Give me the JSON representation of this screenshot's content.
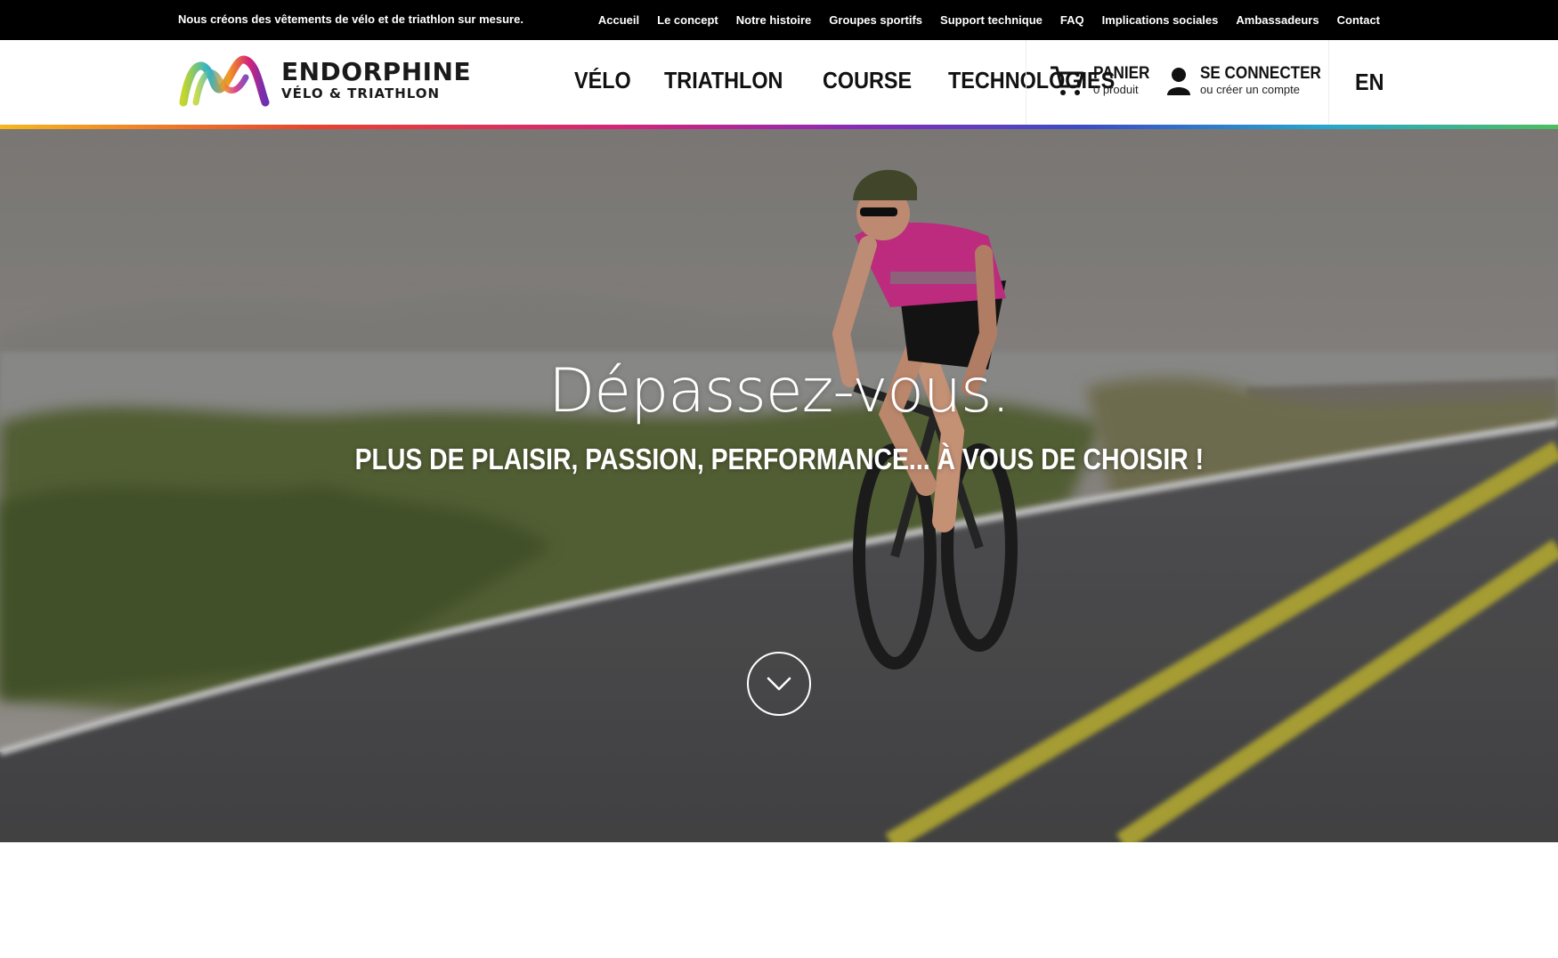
{
  "topbar": {
    "tagline": "Nous créons des vêtements de vélo et de triathlon sur mesure.",
    "links": [
      "Accueil",
      "Le concept",
      "Notre histoire",
      "Groupes sportifs",
      "Support technique",
      "FAQ",
      "Implications sociales",
      "Ambassadeurs",
      "Contact"
    ]
  },
  "header": {
    "logo": {
      "brand": "ENDORPHINE",
      "sub": "VÉLO & TRIATHLON"
    },
    "nav": [
      "VÉLO",
      "TRIATHLON",
      "COURSE",
      "TECHNOLOGIES"
    ],
    "cart": {
      "label": "PANIER",
      "count_text": "0 produit",
      "icon": "shopping-cart-icon"
    },
    "account": {
      "label": "SE CONNECTER",
      "sub": "ou créer un compte",
      "icon": "user-icon"
    },
    "language": "EN"
  },
  "hero": {
    "title": "Dépassez-vous.",
    "subtitle": "PLUS DE PLAISIR, PASSION, PERFORMANCE... À VOUS DE CHOISIR !",
    "scroll_icon": "chevron-down-icon"
  },
  "colors": {
    "topbar_bg": "#000000",
    "header_bg": "#ffffff",
    "text_dark": "#111111",
    "rainbow": [
      "#f7b71d",
      "#e8432d",
      "#d6237a",
      "#8a2bb8",
      "#3a4fc4",
      "#24a6d0",
      "#4cbf5c"
    ]
  }
}
